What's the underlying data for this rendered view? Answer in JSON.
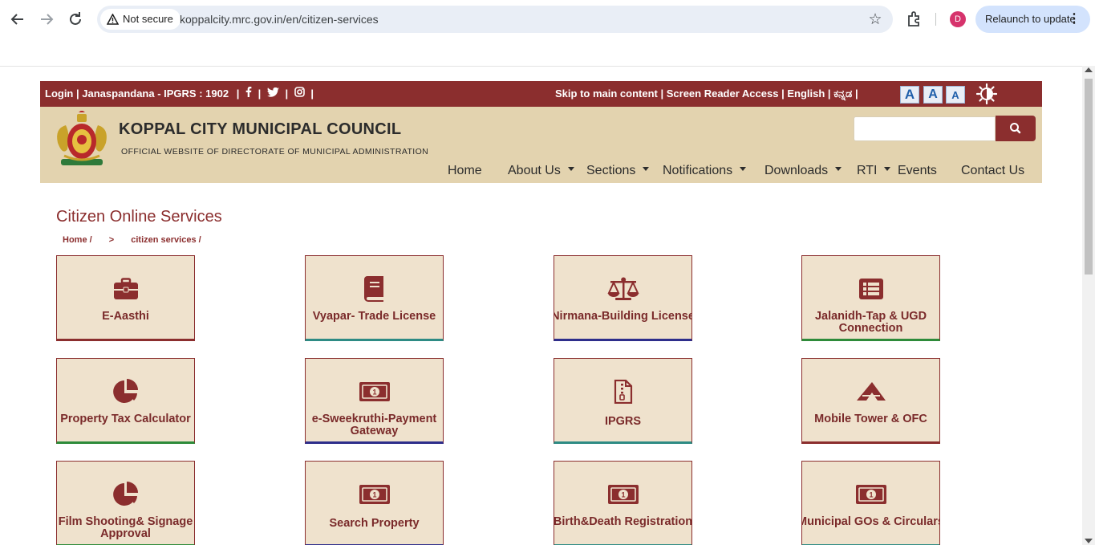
{
  "browser": {
    "security_chip": "Not secure",
    "url": "koppalcity.mrc.gov.in/en/citizen-services",
    "avatar_letter": "D",
    "relaunch_label": "Relaunch to update"
  },
  "topbar": {
    "login": "Login",
    "janaspandana": "Janaspandana - IPGRS : 1902",
    "skip": "Skip to main content",
    "screen_reader": "Screen Reader Access",
    "english": "English",
    "kannada": "ಕನ್ನಡ",
    "sep": "|",
    "font_plus": "A",
    "font_normal": "A",
    "font_minus": "A"
  },
  "header": {
    "title": "KOPPAL CITY MUNICIPAL COUNCIL",
    "subtitle": "OFFICIAL WEBSITE OF DIRECTORATE OF MUNICIPAL ADMINISTRATION",
    "search_placeholder": ""
  },
  "nav": {
    "home": "Home",
    "about": "About Us",
    "sections": "Sections",
    "notifications": "Notifications",
    "downloads": "Downloads",
    "rti": "RTI",
    "events": "Events",
    "contact": "Contact Us"
  },
  "page": {
    "title": "Citizen Online Services",
    "breadcrumb_home": "Home /",
    "breadcrumb_sep": ">",
    "breadcrumb_current": "citizen services /"
  },
  "services": [
    {
      "label": "E-Aasthi",
      "icon": "briefcase-icon",
      "accent": "#8b2e2e"
    },
    {
      "label": "Vyapar- Trade License",
      "icon": "book-icon",
      "accent": "#2e8b84"
    },
    {
      "label": "Nirmana-Building License",
      "icon": "scales-icon",
      "accent": "#2e2e8b"
    },
    {
      "label": "Jalanidh-Tap & UGD Connection",
      "icon": "list-icon",
      "accent": "#2e8b3a"
    },
    {
      "label": "Property Tax Calculator",
      "icon": "pie-chart-icon",
      "accent": "#2e8b3a"
    },
    {
      "label": "e-Sweekruthi-Payment Gateway",
      "icon": "money-icon",
      "accent": "#2e2e8b"
    },
    {
      "label": "IPGRS",
      "icon": "file-zip-icon",
      "accent": "#2e8b84"
    },
    {
      "label": "Mobile Tower & OFC",
      "icon": "tower-icon",
      "accent": "#8b2e2e"
    },
    {
      "label": "Film Shooting& Signage Approval",
      "icon": "pie-chart-icon",
      "accent": "#2e8b3a"
    },
    {
      "label": "Search Property",
      "icon": "money-icon",
      "accent": "#2e2e8b"
    },
    {
      "label": "Birth&Death Registration",
      "icon": "money-icon",
      "accent": "#2e8b84"
    },
    {
      "label": "Municipal GOs & Circulars",
      "icon": "money-icon",
      "accent": "#2e8b84"
    }
  ],
  "colors": {
    "brand": "#8b2e2e",
    "header_bg": "#e3d3af",
    "tile_bg": "#efe2cd"
  }
}
